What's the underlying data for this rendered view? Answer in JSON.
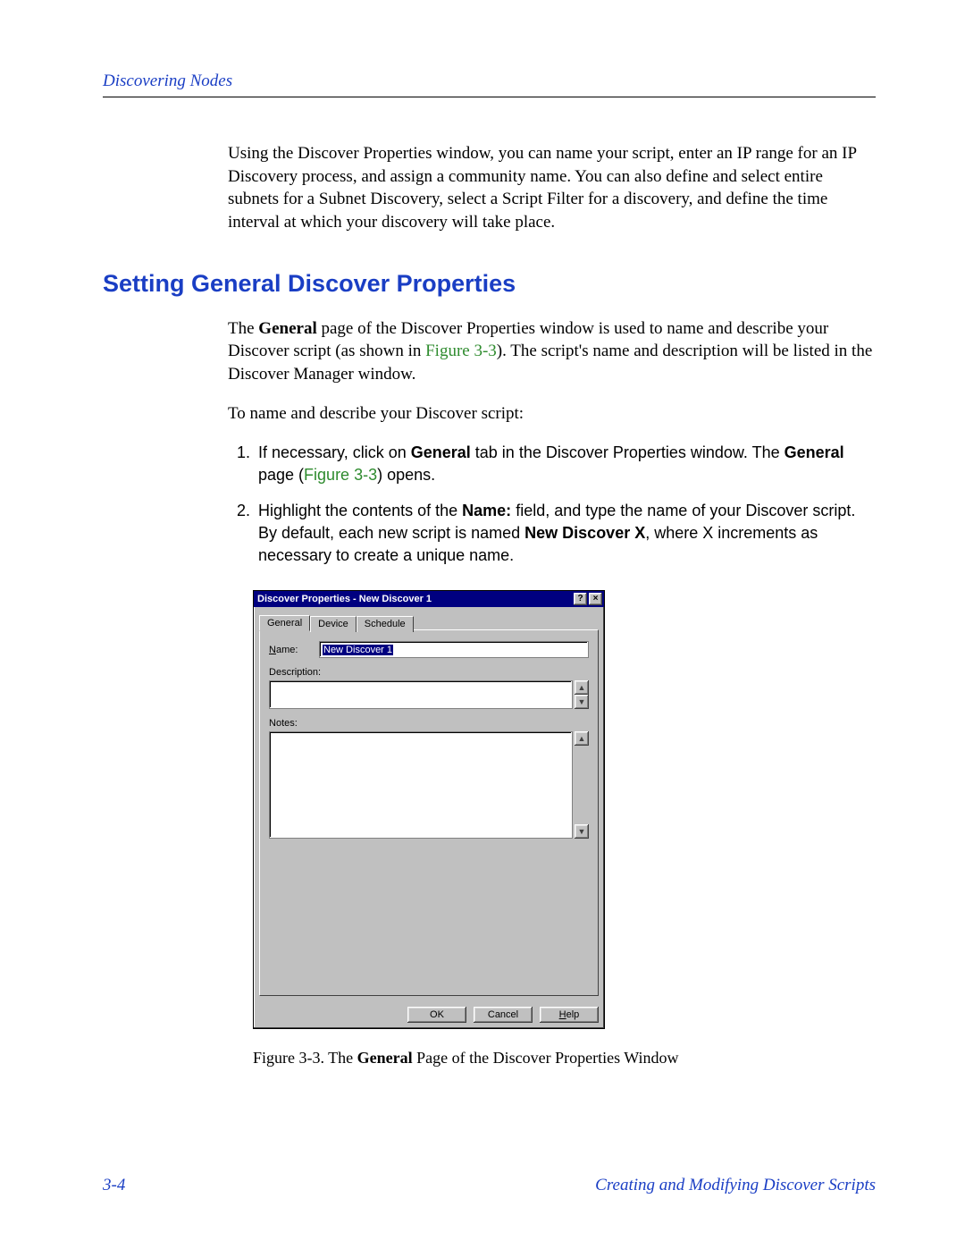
{
  "header": {
    "left": "Discovering Nodes"
  },
  "intro": "Using the Discover Properties window, you can name your script, enter an IP range for an IP Discovery process, and assign a community name. You can also define and select entire subnets for a Subnet Discovery, select a Script Filter for a discovery, and define the time interval at which your discovery will take place.",
  "section_title": "Setting General Discover Properties",
  "para1_pre": "The ",
  "para1_gen": "General",
  "para1_mid": " page of the Discover Properties window is used to name and describe your Discover script (as shown in ",
  "para1_fig": "Figure 3-3",
  "para1_post": "). The script's name and description will be listed in the Discover Manager window.",
  "para2": "To name and describe your Discover script:",
  "steps": {
    "s1_a": "If necessary, click on ",
    "s1_b": "General",
    "s1_c": " tab in the Discover Properties window. The ",
    "s1_d": "General",
    "s1_e": " page (",
    "s1_fig": "Figure 3-3",
    "s1_f": ") opens.",
    "s2_a": "Highlight the contents of the ",
    "s2_b": "Name:",
    "s2_c": " field, and type the name of your Discover script. By default, each new script is named ",
    "s2_d": "New Discover X",
    "s2_e": ", where X increments as necessary to create a unique name."
  },
  "dialog": {
    "title": "Discover Properties - New Discover 1",
    "help_glyph": "?",
    "close_glyph": "×",
    "tabs": {
      "general": "General",
      "device": "Device",
      "schedule": "Schedule"
    },
    "labels": {
      "name_u": "N",
      "name_rest": "ame:",
      "desc_u": "D",
      "desc_rest": "escription:",
      "notes_pre": "N",
      "notes_u": "o",
      "notes_rest": "tes:"
    },
    "name_value": "New Discover 1",
    "buttons": {
      "ok": "OK",
      "cancel": "Cancel",
      "help_u": "H",
      "help_rest": "elp"
    },
    "arrow_up": "▲",
    "arrow_down": "▼"
  },
  "caption_pre": "Figure 3-3.  The ",
  "caption_b": "General",
  "caption_post": " Page of the Discover Properties Window",
  "footer": {
    "left": "3-4",
    "right": "Creating and Modifying Discover Scripts"
  }
}
